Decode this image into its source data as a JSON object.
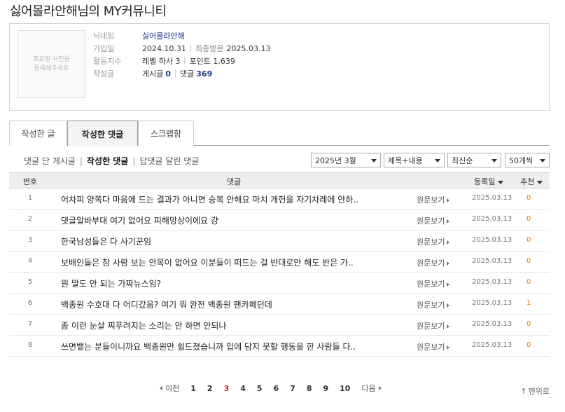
{
  "page_title": "싫어몰라안해님의 MY커뮤니티",
  "profile": {
    "photo_placeholder": "프로필 사진을 등록해주세요",
    "labels": {
      "nickname": "닉네임",
      "joined": "가입일",
      "activity": "활동지수",
      "posts": "작성글"
    },
    "nickname": "싫어몰라안해",
    "joined_date": "2024.10.31",
    "last_visit_label": "최종방문",
    "last_visit": "2025.03.13",
    "level": "레벨 하사 3",
    "points": "포인트 1,639",
    "post_label": "게시글",
    "post_count": "0",
    "comment_label": "댓글",
    "comment_count": "369"
  },
  "tabs": [
    {
      "label": "작성한 글",
      "active": false
    },
    {
      "label": "작성한 댓글",
      "active": true
    },
    {
      "label": "스크랩함",
      "active": false
    }
  ],
  "subtabs": [
    {
      "label": "댓글 단 게시글",
      "active": false
    },
    {
      "label": "작성한 댓글",
      "active": true
    },
    {
      "label": "답댓글 달린 댓글",
      "active": false
    }
  ],
  "filters": {
    "month": "2025년 3월",
    "search_scope": "제목+내용",
    "sort": "최신순",
    "per_page": "50개씩"
  },
  "table": {
    "headers": {
      "num": "번호",
      "comment": "댓글",
      "date": "등록일",
      "rec": "추천"
    },
    "view_label": "원문보기",
    "rows": [
      {
        "num": "1",
        "text": "어차피 양쪽다 마음에 드는 결과가 아니면 승복 안해요 마치 개헌을 자기차례에 안하..",
        "date": "2025.03.13",
        "rec": "0"
      },
      {
        "num": "2",
        "text": "댓글알바부대 여기 없어요 피해망상이에요 걍",
        "date": "2025.03.13",
        "rec": "0"
      },
      {
        "num": "3",
        "text": "한국남성들은 다 사기꾼임",
        "date": "2025.03.13",
        "rec": "0"
      },
      {
        "num": "4",
        "text": "보배인들은 참 사람 보는 안목이 없어요 이분들이 떠드는 걸 반대로만 해도 반은 가..",
        "date": "2025.03.13",
        "rec": "0"
      },
      {
        "num": "5",
        "text": "뭔 말도 안 되는 가짜뉴스임?",
        "date": "2025.03.13",
        "rec": "0"
      },
      {
        "num": "6",
        "text": "백종원 수호대 다 어디갔음? 여기 뭐 완전 백종원 팬카페던데",
        "date": "2025.03.13",
        "rec": "1"
      },
      {
        "num": "7",
        "text": "좀 이런 눈살 찌푸려지는 소리는 안 하면 안되나",
        "date": "2025.03.13",
        "rec": "0"
      },
      {
        "num": "8",
        "text": "쓰면뱉는 분들이니까요 백종원만 쉴드쳤습니까 입에 담지 못할 행동을 한 사람들 다..",
        "date": "2025.03.13",
        "rec": "0"
      }
    ]
  },
  "pager": {
    "prev": "이전",
    "next": "다음",
    "pages": [
      "1",
      "2",
      "3",
      "4",
      "5",
      "6",
      "7",
      "8",
      "9",
      "10"
    ],
    "current": "3"
  },
  "top_link": "맨위로"
}
